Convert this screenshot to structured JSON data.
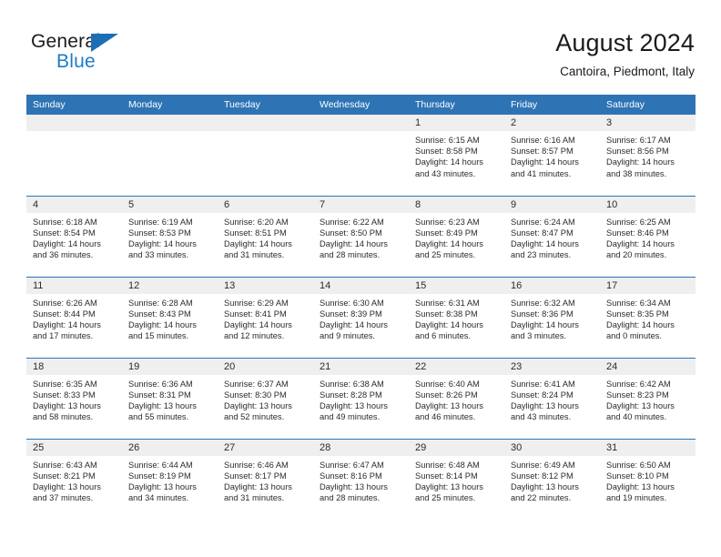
{
  "brand": {
    "name_top": "General",
    "name_bottom": "Blue",
    "accent_color": "#1c7cc4",
    "triangle_color": "#1c6fb5"
  },
  "header": {
    "title": "August 2024",
    "subtitle": "Cantoira, Piedmont, Italy"
  },
  "calendar": {
    "header_bg": "#2e74b5",
    "daynum_bg": "#efefef",
    "weekdays": [
      "Sunday",
      "Monday",
      "Tuesday",
      "Wednesday",
      "Thursday",
      "Friday",
      "Saturday"
    ],
    "weeks": [
      [
        {
          "day": "",
          "sunrise": "",
          "sunset": "",
          "daylight": "",
          "daylight2": ""
        },
        {
          "day": "",
          "sunrise": "",
          "sunset": "",
          "daylight": "",
          "daylight2": ""
        },
        {
          "day": "",
          "sunrise": "",
          "sunset": "",
          "daylight": "",
          "daylight2": ""
        },
        {
          "day": "",
          "sunrise": "",
          "sunset": "",
          "daylight": "",
          "daylight2": ""
        },
        {
          "day": "1",
          "sunrise": "Sunrise: 6:15 AM",
          "sunset": "Sunset: 8:58 PM",
          "daylight": "Daylight: 14 hours",
          "daylight2": "and 43 minutes."
        },
        {
          "day": "2",
          "sunrise": "Sunrise: 6:16 AM",
          "sunset": "Sunset: 8:57 PM",
          "daylight": "Daylight: 14 hours",
          "daylight2": "and 41 minutes."
        },
        {
          "day": "3",
          "sunrise": "Sunrise: 6:17 AM",
          "sunset": "Sunset: 8:56 PM",
          "daylight": "Daylight: 14 hours",
          "daylight2": "and 38 minutes."
        }
      ],
      [
        {
          "day": "4",
          "sunrise": "Sunrise: 6:18 AM",
          "sunset": "Sunset: 8:54 PM",
          "daylight": "Daylight: 14 hours",
          "daylight2": "and 36 minutes."
        },
        {
          "day": "5",
          "sunrise": "Sunrise: 6:19 AM",
          "sunset": "Sunset: 8:53 PM",
          "daylight": "Daylight: 14 hours",
          "daylight2": "and 33 minutes."
        },
        {
          "day": "6",
          "sunrise": "Sunrise: 6:20 AM",
          "sunset": "Sunset: 8:51 PM",
          "daylight": "Daylight: 14 hours",
          "daylight2": "and 31 minutes."
        },
        {
          "day": "7",
          "sunrise": "Sunrise: 6:22 AM",
          "sunset": "Sunset: 8:50 PM",
          "daylight": "Daylight: 14 hours",
          "daylight2": "and 28 minutes."
        },
        {
          "day": "8",
          "sunrise": "Sunrise: 6:23 AM",
          "sunset": "Sunset: 8:49 PM",
          "daylight": "Daylight: 14 hours",
          "daylight2": "and 25 minutes."
        },
        {
          "day": "9",
          "sunrise": "Sunrise: 6:24 AM",
          "sunset": "Sunset: 8:47 PM",
          "daylight": "Daylight: 14 hours",
          "daylight2": "and 23 minutes."
        },
        {
          "day": "10",
          "sunrise": "Sunrise: 6:25 AM",
          "sunset": "Sunset: 8:46 PM",
          "daylight": "Daylight: 14 hours",
          "daylight2": "and 20 minutes."
        }
      ],
      [
        {
          "day": "11",
          "sunrise": "Sunrise: 6:26 AM",
          "sunset": "Sunset: 8:44 PM",
          "daylight": "Daylight: 14 hours",
          "daylight2": "and 17 minutes."
        },
        {
          "day": "12",
          "sunrise": "Sunrise: 6:28 AM",
          "sunset": "Sunset: 8:43 PM",
          "daylight": "Daylight: 14 hours",
          "daylight2": "and 15 minutes."
        },
        {
          "day": "13",
          "sunrise": "Sunrise: 6:29 AM",
          "sunset": "Sunset: 8:41 PM",
          "daylight": "Daylight: 14 hours",
          "daylight2": "and 12 minutes."
        },
        {
          "day": "14",
          "sunrise": "Sunrise: 6:30 AM",
          "sunset": "Sunset: 8:39 PM",
          "daylight": "Daylight: 14 hours",
          "daylight2": "and 9 minutes."
        },
        {
          "day": "15",
          "sunrise": "Sunrise: 6:31 AM",
          "sunset": "Sunset: 8:38 PM",
          "daylight": "Daylight: 14 hours",
          "daylight2": "and 6 minutes."
        },
        {
          "day": "16",
          "sunrise": "Sunrise: 6:32 AM",
          "sunset": "Sunset: 8:36 PM",
          "daylight": "Daylight: 14 hours",
          "daylight2": "and 3 minutes."
        },
        {
          "day": "17",
          "sunrise": "Sunrise: 6:34 AM",
          "sunset": "Sunset: 8:35 PM",
          "daylight": "Daylight: 14 hours",
          "daylight2": "and 0 minutes."
        }
      ],
      [
        {
          "day": "18",
          "sunrise": "Sunrise: 6:35 AM",
          "sunset": "Sunset: 8:33 PM",
          "daylight": "Daylight: 13 hours",
          "daylight2": "and 58 minutes."
        },
        {
          "day": "19",
          "sunrise": "Sunrise: 6:36 AM",
          "sunset": "Sunset: 8:31 PM",
          "daylight": "Daylight: 13 hours",
          "daylight2": "and 55 minutes."
        },
        {
          "day": "20",
          "sunrise": "Sunrise: 6:37 AM",
          "sunset": "Sunset: 8:30 PM",
          "daylight": "Daylight: 13 hours",
          "daylight2": "and 52 minutes."
        },
        {
          "day": "21",
          "sunrise": "Sunrise: 6:38 AM",
          "sunset": "Sunset: 8:28 PM",
          "daylight": "Daylight: 13 hours",
          "daylight2": "and 49 minutes."
        },
        {
          "day": "22",
          "sunrise": "Sunrise: 6:40 AM",
          "sunset": "Sunset: 8:26 PM",
          "daylight": "Daylight: 13 hours",
          "daylight2": "and 46 minutes."
        },
        {
          "day": "23",
          "sunrise": "Sunrise: 6:41 AM",
          "sunset": "Sunset: 8:24 PM",
          "daylight": "Daylight: 13 hours",
          "daylight2": "and 43 minutes."
        },
        {
          "day": "24",
          "sunrise": "Sunrise: 6:42 AM",
          "sunset": "Sunset: 8:23 PM",
          "daylight": "Daylight: 13 hours",
          "daylight2": "and 40 minutes."
        }
      ],
      [
        {
          "day": "25",
          "sunrise": "Sunrise: 6:43 AM",
          "sunset": "Sunset: 8:21 PM",
          "daylight": "Daylight: 13 hours",
          "daylight2": "and 37 minutes."
        },
        {
          "day": "26",
          "sunrise": "Sunrise: 6:44 AM",
          "sunset": "Sunset: 8:19 PM",
          "daylight": "Daylight: 13 hours",
          "daylight2": "and 34 minutes."
        },
        {
          "day": "27",
          "sunrise": "Sunrise: 6:46 AM",
          "sunset": "Sunset: 8:17 PM",
          "daylight": "Daylight: 13 hours",
          "daylight2": "and 31 minutes."
        },
        {
          "day": "28",
          "sunrise": "Sunrise: 6:47 AM",
          "sunset": "Sunset: 8:16 PM",
          "daylight": "Daylight: 13 hours",
          "daylight2": "and 28 minutes."
        },
        {
          "day": "29",
          "sunrise": "Sunrise: 6:48 AM",
          "sunset": "Sunset: 8:14 PM",
          "daylight": "Daylight: 13 hours",
          "daylight2": "and 25 minutes."
        },
        {
          "day": "30",
          "sunrise": "Sunrise: 6:49 AM",
          "sunset": "Sunset: 8:12 PM",
          "daylight": "Daylight: 13 hours",
          "daylight2": "and 22 minutes."
        },
        {
          "day": "31",
          "sunrise": "Sunrise: 6:50 AM",
          "sunset": "Sunset: 8:10 PM",
          "daylight": "Daylight: 13 hours",
          "daylight2": "and 19 minutes."
        }
      ]
    ]
  }
}
